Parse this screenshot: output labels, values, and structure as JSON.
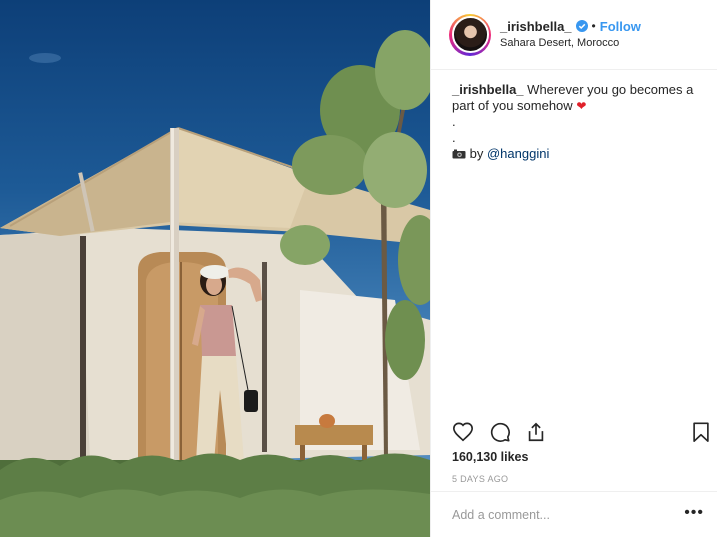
{
  "post": {
    "username": "_irishbella_",
    "follow_label": "Follow",
    "separator": "•",
    "location": "Sahara Desert, Morocco",
    "caption": {
      "user": "_irishbella_",
      "text": "Wherever you go becomes a part of you somehow",
      "heart": "❤",
      "dot1": ".",
      "dot2": ".",
      "camera_icon": "camera-emoji",
      "by_label": "by",
      "mention": "@hanggini"
    },
    "likes": "160,130 likes",
    "time_ago": "5 DAYS AGO",
    "comment_placeholder": "Add a comment...",
    "more_label": "•••",
    "icons": [
      "heart-icon",
      "comment-icon",
      "share-icon",
      "bookmark-icon",
      "verified-badge-icon"
    ],
    "colors": {
      "follow": "#3897f0",
      "verified": "#3897f0",
      "heart": "#e0202a",
      "muted": "#999999"
    }
  }
}
